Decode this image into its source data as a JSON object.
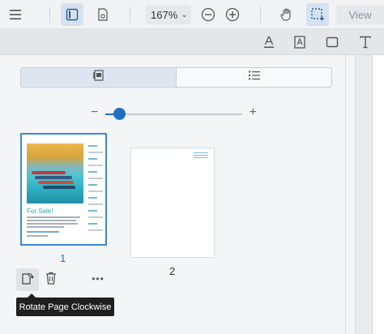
{
  "toolbar": {
    "zoom": {
      "value": "167",
      "unit": "%",
      "chevron": "⌄"
    },
    "view_label": "View",
    "icons": [
      "menu-icon",
      "sidebar-panel-icon",
      "file-settings-icon",
      "zoom-out-icon",
      "zoom-in-icon",
      "hand-pan-icon",
      "region-select-icon"
    ]
  },
  "annotation_toolbar": {
    "icons": [
      "text-underline-icon",
      "text-field-icon",
      "rectangle-icon",
      "text-tool-icon"
    ]
  },
  "panel": {
    "view_toggle": {
      "selected": "thumbnails",
      "options": [
        "thumbnails",
        "outline-list"
      ]
    },
    "thumbnail_size": {
      "minus_label": "−",
      "plus_label": "+",
      "level": 0.1
    },
    "thumbnails": [
      {
        "page_label": "1",
        "selected": true,
        "preview_title": "For Sale!"
      },
      {
        "page_label": "2",
        "selected": false
      }
    ],
    "page_actions": {
      "more_label": "•••"
    },
    "tooltip": "Rotate Page Clockwise"
  },
  "colors": {
    "accent": "#1f6fbf",
    "selected_border": "#3b86d6",
    "tooltip_bg": "#1f1f1f"
  }
}
